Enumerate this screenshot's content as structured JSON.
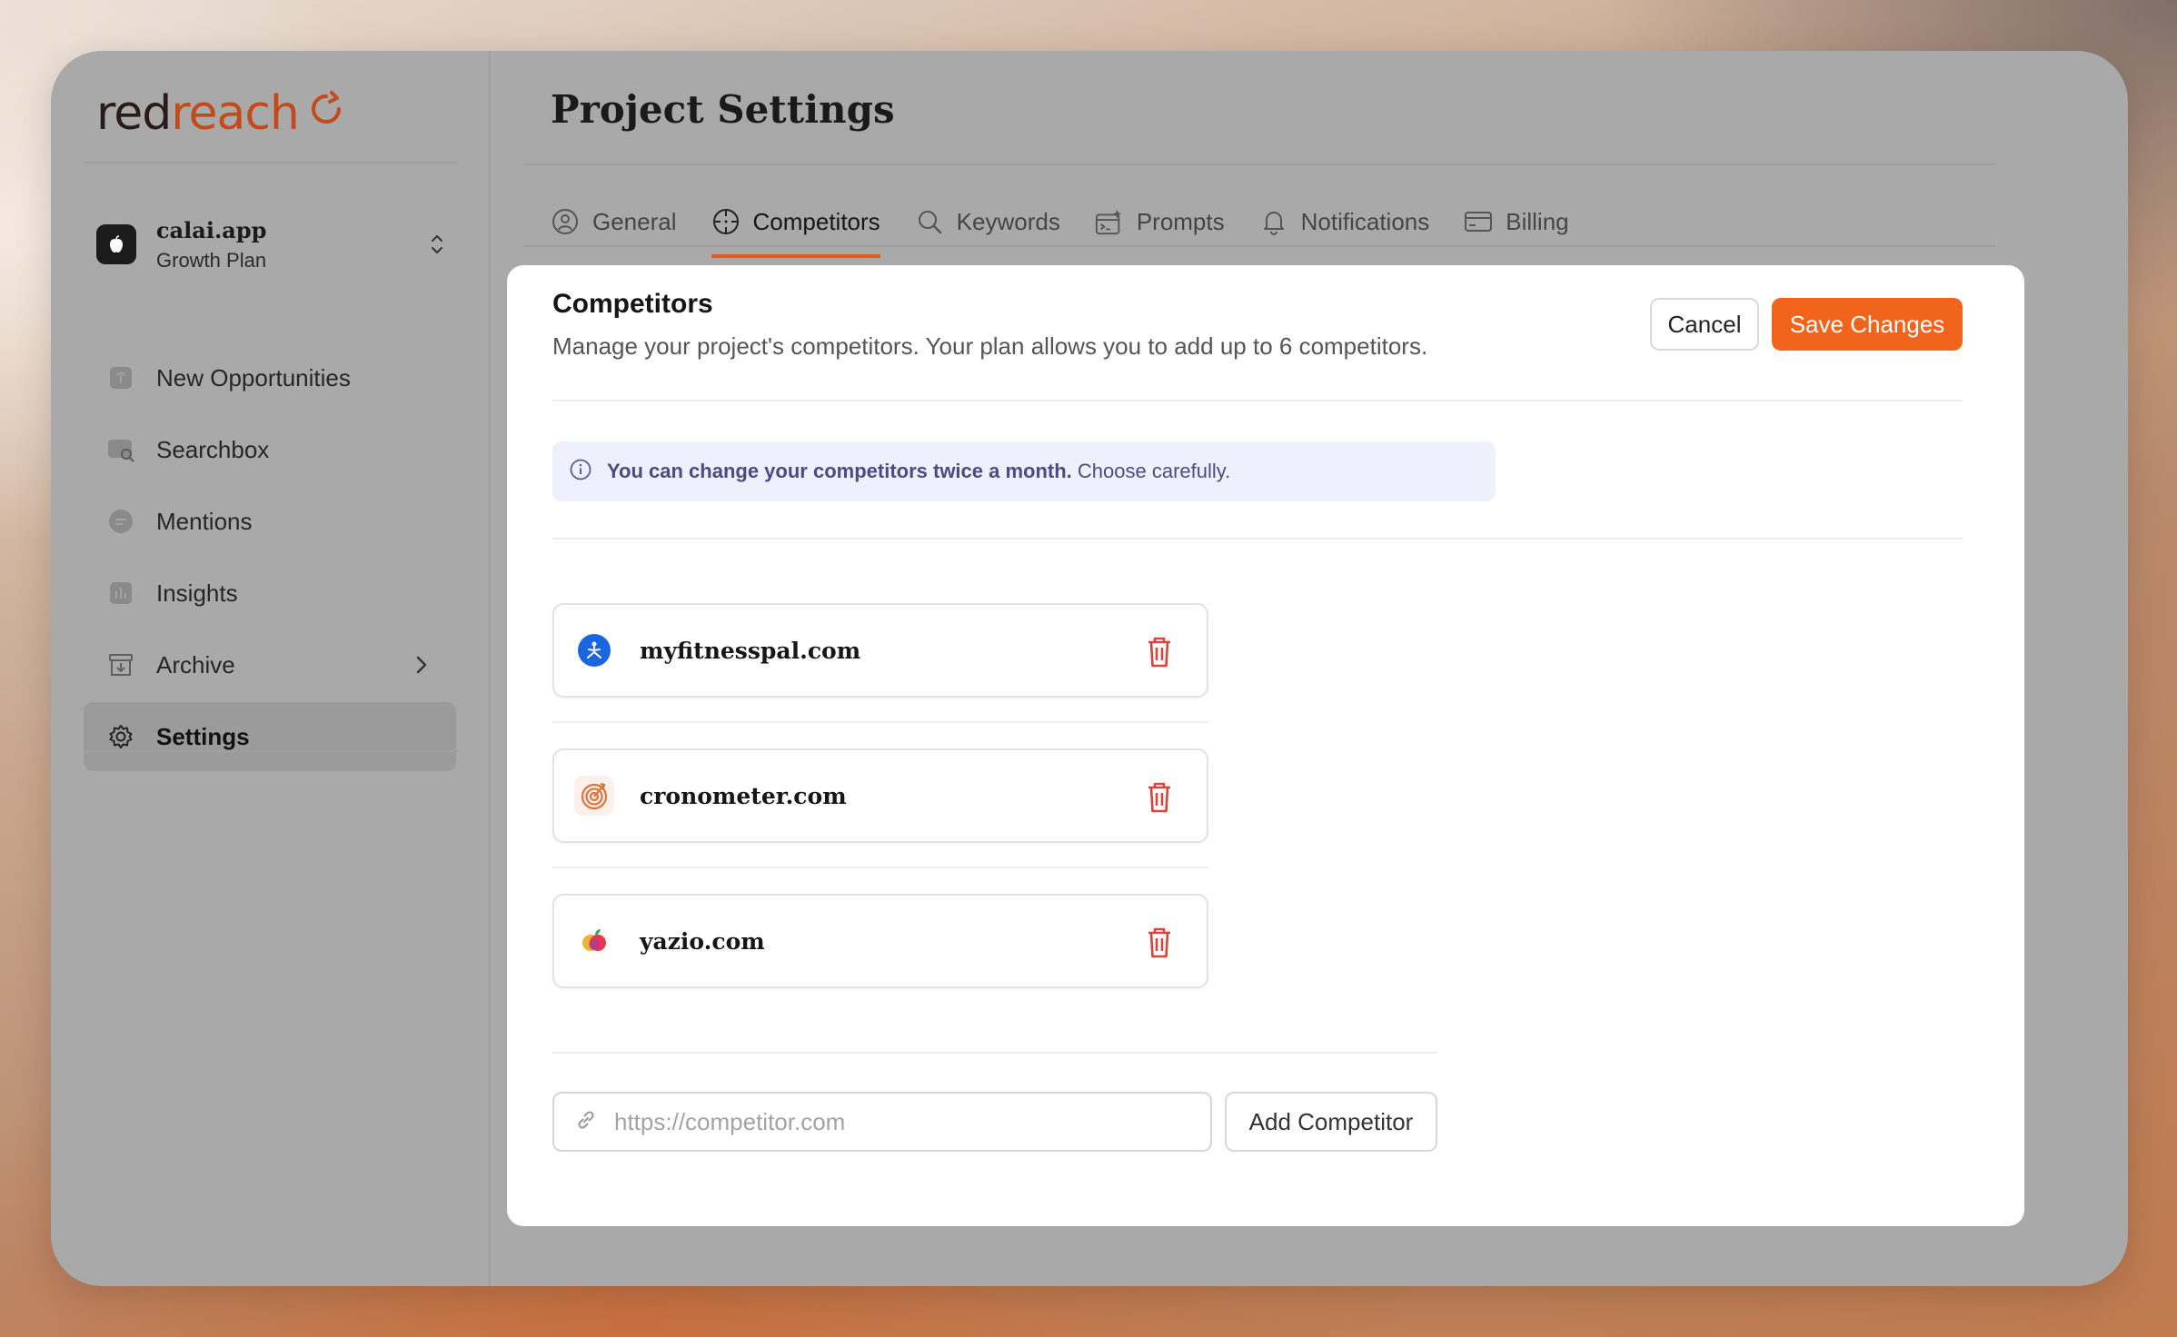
{
  "app": {
    "logo_part1": "red",
    "logo_part2": "reach"
  },
  "project": {
    "name": "calai.app",
    "plan": "Growth Plan"
  },
  "sidebar": {
    "items": [
      {
        "label": "New Opportunities",
        "icon": "opportunities-icon"
      },
      {
        "label": "Searchbox",
        "icon": "searchbox-icon"
      },
      {
        "label": "Mentions",
        "icon": "mentions-icon"
      },
      {
        "label": "Insights",
        "icon": "insights-icon"
      },
      {
        "label": "Archive",
        "icon": "archive-icon"
      },
      {
        "label": "Settings",
        "icon": "gear-icon",
        "active": true
      }
    ]
  },
  "page": {
    "title": "Project Settings"
  },
  "tabs": [
    {
      "label": "General",
      "icon": "user-circle-icon"
    },
    {
      "label": "Competitors",
      "icon": "crosshair-icon",
      "active": true
    },
    {
      "label": "Keywords",
      "icon": "search-icon"
    },
    {
      "label": "Prompts",
      "icon": "prompt-icon"
    },
    {
      "label": "Notifications",
      "icon": "bell-icon"
    },
    {
      "label": "Billing",
      "icon": "credit-card-icon"
    }
  ],
  "competitors_section": {
    "title": "Competitors",
    "description": "Manage your project's competitors. Your plan allows you to add up to 6 competitors.",
    "cancel_label": "Cancel",
    "save_label": "Save Changes",
    "info_bold": "You can change your competitors twice a month.",
    "info_rest": " Choose carefully.",
    "list": [
      {
        "domain": "myfitnesspal.com"
      },
      {
        "domain": "cronometer.com"
      },
      {
        "domain": "yazio.com"
      }
    ],
    "input_placeholder": "https://competitor.com",
    "input_value": "",
    "add_label": "Add Competitor"
  },
  "colors": {
    "accent": "#f2641c",
    "tab_underline": "#e25c1c",
    "delete": "#d9453a"
  }
}
